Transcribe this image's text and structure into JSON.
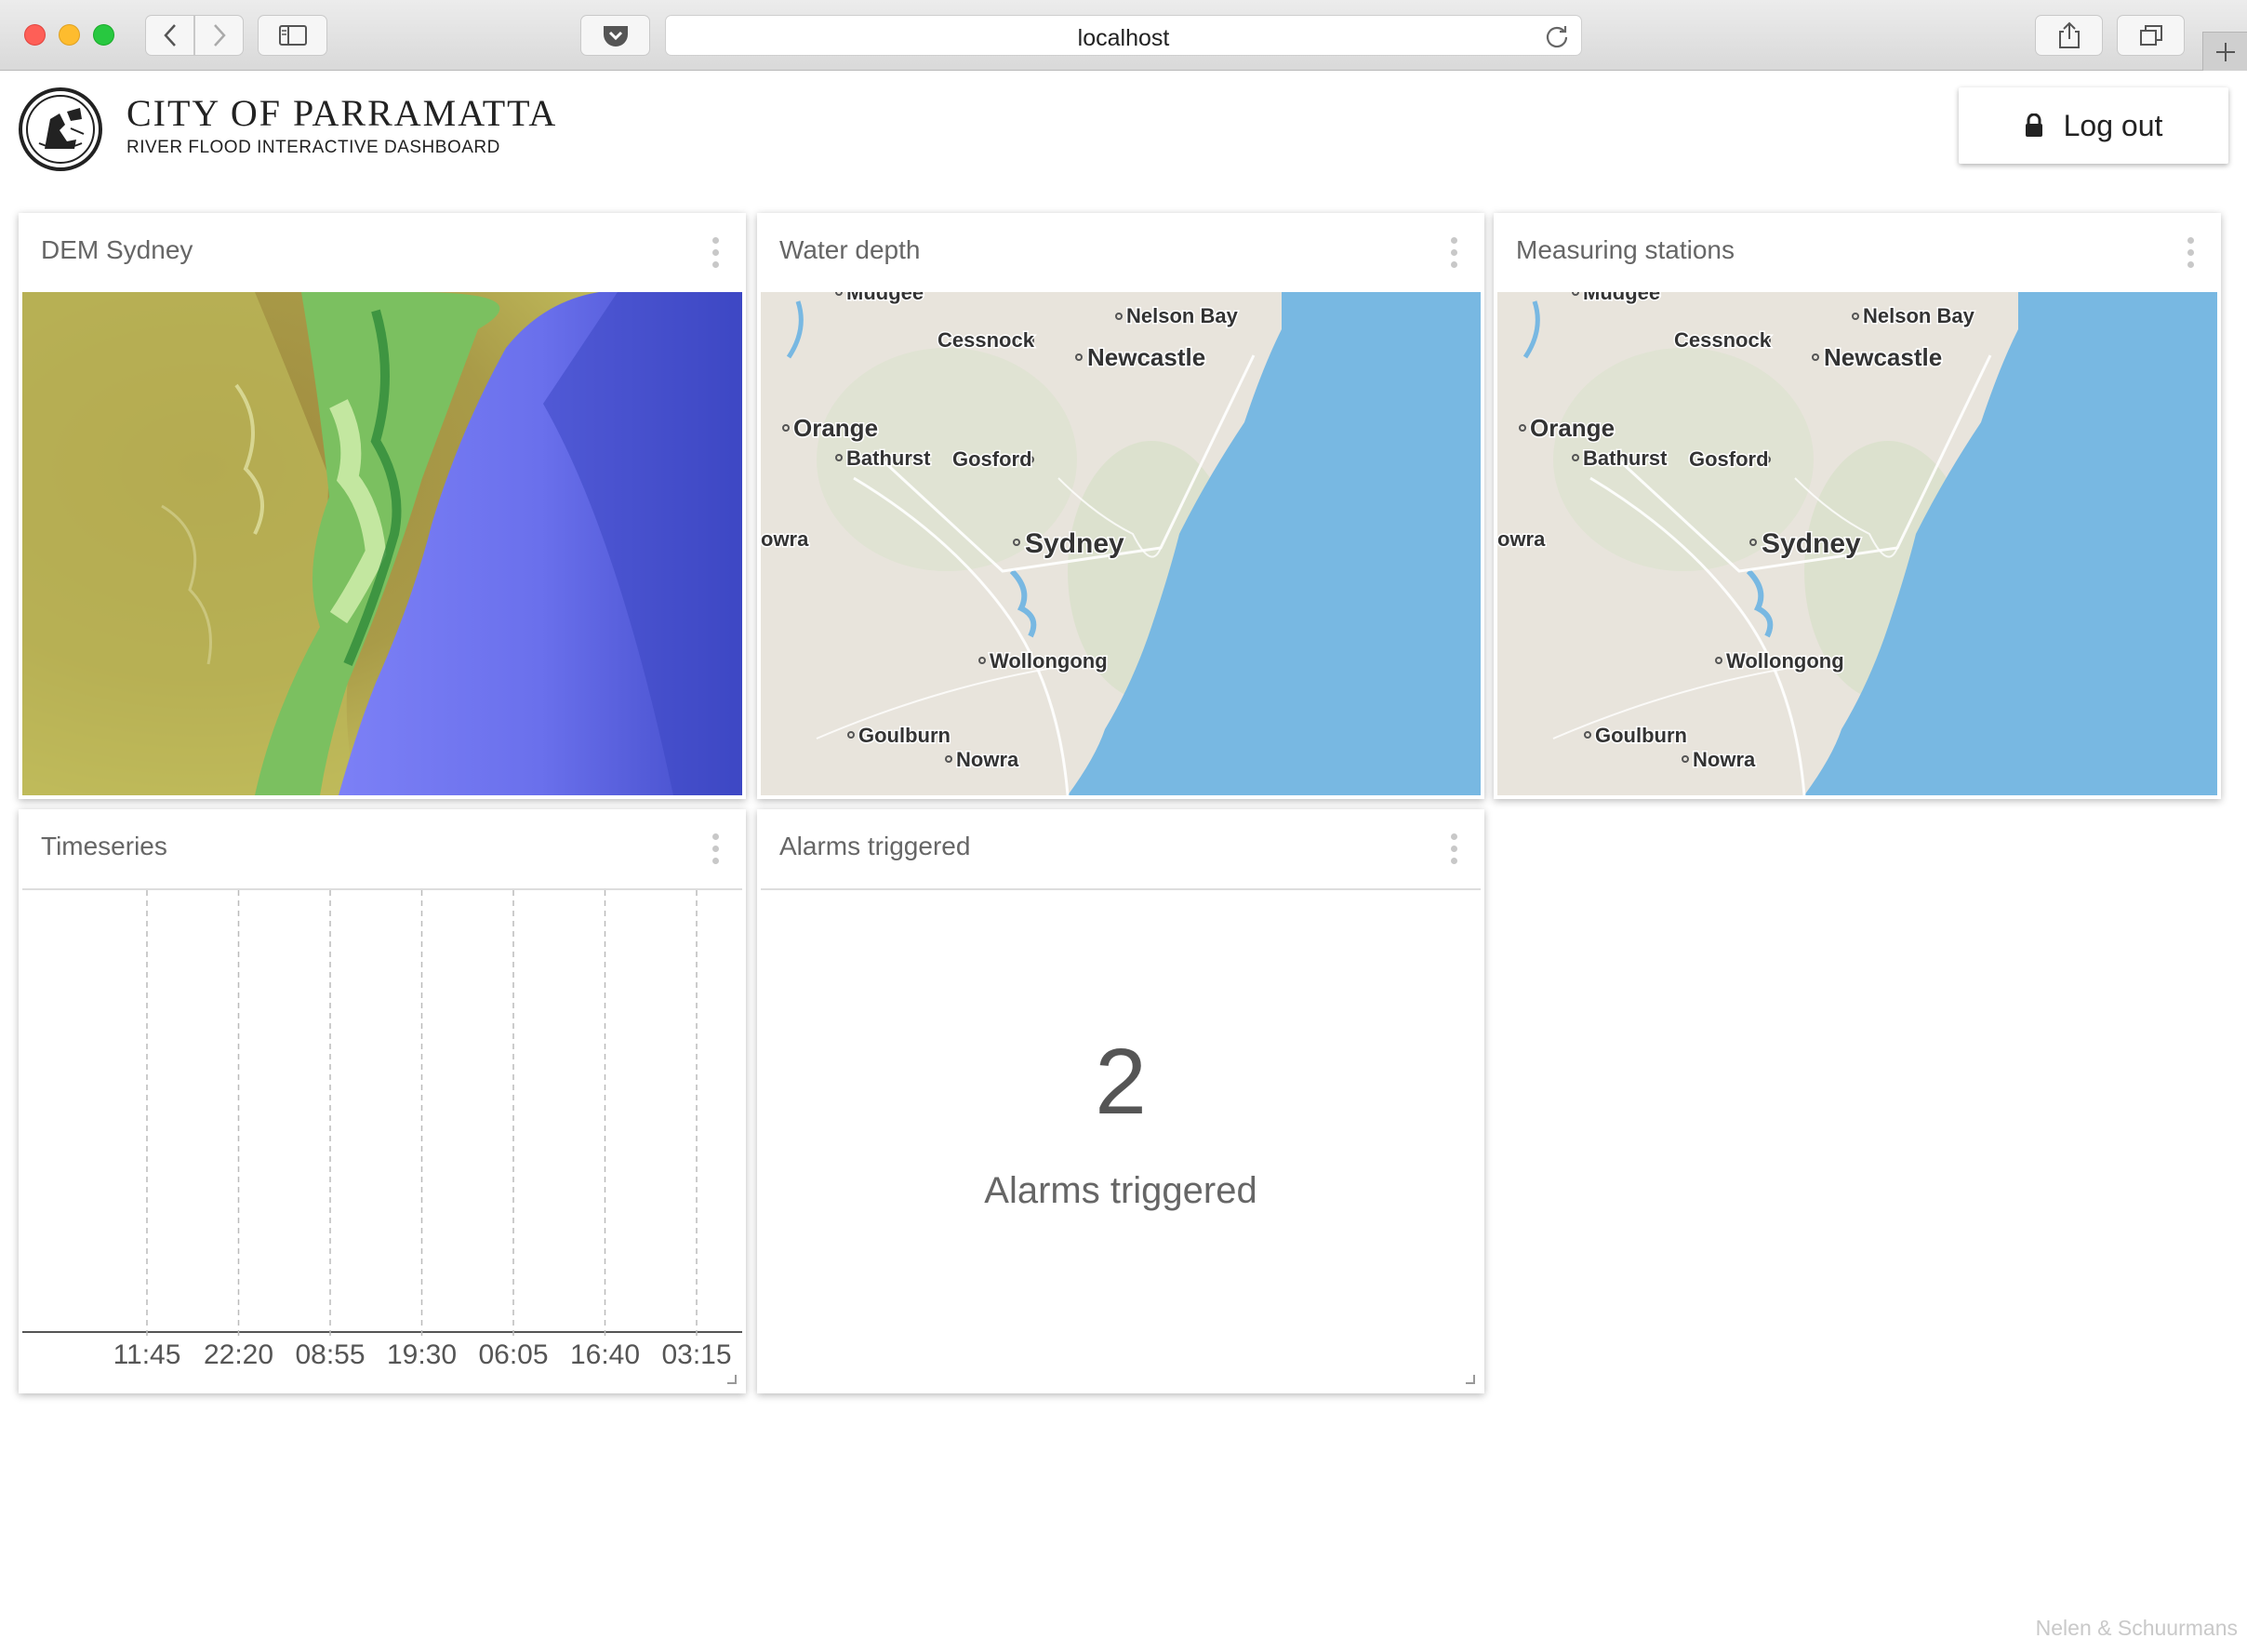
{
  "browser": {
    "url": "localhost"
  },
  "header": {
    "org_title": "CITY OF PARRAMATTA",
    "subtitle": "RIVER FLOOD INTERACTIVE DASHBOARD",
    "logout_label": "Log out"
  },
  "tiles": {
    "dem": {
      "title": "DEM Sydney"
    },
    "water": {
      "title": "Water depth"
    },
    "stations": {
      "title": "Measuring stations"
    },
    "timeseries": {
      "title": "Timeseries",
      "ticks": [
        "11:45",
        "22:20",
        "08:55",
        "19:30",
        "06:05",
        "16:40",
        "03:15"
      ]
    },
    "alarms": {
      "title": "Alarms triggered",
      "count": "2",
      "label": "Alarms triggered"
    }
  },
  "map_labels": {
    "mudgee": "Mudgee",
    "nelson_bay": "Nelson Bay",
    "cessnock": "Cessnock",
    "newcastle": "Newcastle",
    "orange": "Orange",
    "bathurst": "Bathurst",
    "gosford": "Gosford",
    "sydney": "Sydney",
    "cowra": "owra",
    "wollongong": "Wollongong",
    "goulburn": "Goulburn",
    "nowra": "Nowra"
  },
  "colors": {
    "map_land": "#e8e4dc",
    "map_sea": "#78b8e2",
    "dem_sea": "#7478f2",
    "dem_deep": "#3a44c0"
  },
  "footer": "Nelen & Schuurmans"
}
